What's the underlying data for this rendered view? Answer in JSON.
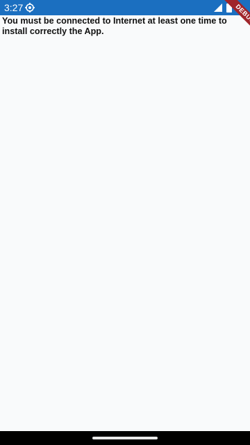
{
  "status_bar": {
    "time": "3:27",
    "icons": [
      "settings-icon",
      "signal-icon",
      "battery-icon"
    ],
    "color": "#1b6fc0"
  },
  "debug_banner": {
    "label": "DEBUG",
    "color": "#a0252b"
  },
  "main": {
    "message": "You must be connected to Internet at least one time to install correctly the App."
  },
  "nav_bar": {
    "icons": [
      "home-indicator"
    ]
  }
}
